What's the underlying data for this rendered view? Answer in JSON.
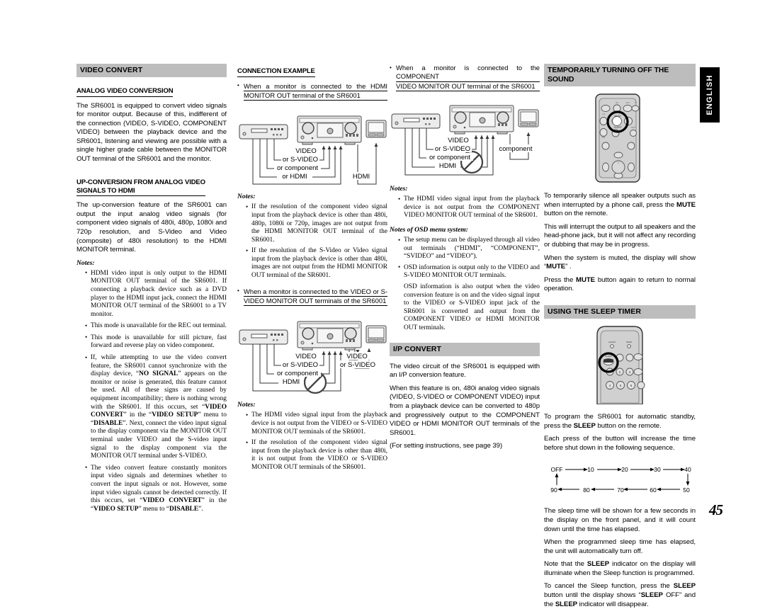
{
  "page": {
    "number": "45",
    "language_tab": "ENGLISH"
  },
  "col1": {
    "header": "VIDEO CONVERT",
    "sub1": "ANALOG VIDEO CONVERSION",
    "p1": "The SR6001 is equipped to convert video signals for monitor output. Because of this, indifferent of the connection (VIDEO, S-VIDEO, COMPONENT VIDEO) between the playback device and the SR6001, listening and viewing are possible with a single higher grade cable between the MONITOR OUT terminal of the SR6001 and the monitor.",
    "sub2_line1": "UP-CONVERSION FROM ANALOG VIDEO",
    "sub2_line2": "SIGNALS TO HDMI",
    "p2": "The up-conversion feature of the SR6001 can output the input analog video signals (for component video signals of 480i, 480p, 1080i and 720p resolution, and S-Video and Video (composite) of 480i resolution) to the HDMI MONITOR terminal.",
    "notes_label": "Notes:",
    "notes": [
      "HDMI video input is only output to the HDMI MONITOR OUT terminal of the SR6001. If connecting a playback device such as a DVD player to the HDMI input jack, connect the HDMI MONITOR OUT terminal of the SR6001 to a TV monitor.",
      "This mode is unavailable for the REC out terminal.",
      "This mode is unavailable for still picture, fast forward and reverse play on video component.",
      "If, while attempting to use the video convert feature, the SR6001 cannot synchronize with the display device, “NO SIGNAL” appears on the monitor or noise is generated, this feature cannot be used. All of these signs are caused by equipment incompatibility; there is nothing wrong with the SR6001. If this occurs, set “VIDEO CONVERT” in the “VIDEO SETUP” menu to “DISABLE”. Next, connect the video input signal to the display component via the MONITOR OUT terminal under VIDEO and the S-video input signal to the display component via the MONITOR OUT terminal under S-VIDEO.",
      "The video convert feature constantly monitors input video signals and determines whether to convert the input signals or not. However, some input video signals cannot be detected correctly. If this occurs, set “VIDEO CONVERT” in the “VIDEO SETUP” menu to “DISABLE”."
    ]
  },
  "col2": {
    "header": "CONNECTION EXAMPLE",
    "item1_line1": "When a monitor is connected to the HDMI",
    "item1_line2": "MONITOR OUT terminal of the SR6001",
    "diagram1_labels": [
      "VIDEO",
      "or S-VIDEO",
      "or component",
      "or HDMI",
      "HDMI"
    ],
    "notes_label_1": "Notes:",
    "notes1": [
      "If the resolution of the component video signal input from the playback device is other than 480i, 480p, 1080i or 720p, images are not output from the HDMI MONITOR OUT terminal of the SR6001.",
      "If the resolution of the S-Video or Video signal input from the playback device is other than 480i, images are not output from the HDMI MONITOR OUT terminal of the SR6001."
    ],
    "item2_line1": "When a monitor is connected to the VIDEO or S-",
    "item2_line2": "VIDEO MONITOR OUT terminals of the SR6001",
    "diagram2_labels": [
      "VIDEO",
      "or S-VIDEO",
      "or component",
      "HDMI",
      "VIDEO",
      "or S-VIDEO"
    ],
    "notes_label_2": "Notes:",
    "notes2": [
      "The HDMI video signal input from the playback device is not output from the VIDEO or S-VIDEO MONITOR OUT terminals of the SR6001.",
      "If the resolution of the component video signal input from the playback device is other than 480i, it is not output from the VIDEO or S-VIDEO MONITOR OUT terminals of the SR6001."
    ]
  },
  "col3": {
    "item3_line1": "When a monitor is connected to the COMPONENT",
    "item3_line2": "VIDEO MONITOR OUT terminal of the SR6001",
    "diagram3_labels": [
      "VIDEO",
      "or S-VIDEO",
      "or component",
      "HDMI",
      "component"
    ],
    "notes_label_1": "Notes:",
    "notes1": [
      "The HDMI video signal input from the playback device is not output from the COMPONENT VIDEO MONITOR OUT terminal of the SR6001."
    ],
    "notes_label_2": "Notes of OSD menu system:",
    "notes2": [
      "The setup menu can be displayed through all video out terminals (“HDMI”, “COMPONENT”, “SVIDEO” and “VIDEO”).",
      "OSD information is output only to the VIDEO and S-VIDEO MONITOR OUT terminals."
    ],
    "notes2_extra": "OSD information is also output when the video conversion feature is on and the video signal input to the VIDEO or S-VIDEO input jack of the SR6001 is converted and output from the COMPONENT VIDEO or HDMI MONITOR OUT terminals.",
    "header2": "I/P CONVERT",
    "p1": "The video circuit of the SR6001 is equipped with an I/P conversion feature.",
    "p2": "When this feature is on, 480i analog video signals (VIDEO, S-VIDEO or COMPONENT VIDEO) input from a playback device can be converted to 480p and progressively output to the COMPONENT VIDEO or HDMI MONITOR OUT terminals of the SR6001.",
    "p3": "(For setting instructions, see page 39)"
  },
  "col4": {
    "header1": "TEMPORARILY TURNING OFF  THE SOUND",
    "remote1_labels": [
      "MUTE",
      "SLEEP"
    ],
    "p1": "To temporarily silence all speaker outputs such as when interrupted by a phone call, press the MUTE button on the remote.",
    "p1_bold": "MUTE",
    "p2": "This will interrupt the output to all speakers and the head-phone jack, but it will not affect any recording or dubbing that may be in progress.",
    "p3": "When the system is muted, the display will show “MUTE” .",
    "p3_bold": "MUTE",
    "p4": "Press the MUTE button again to return to normal operation.",
    "header2": "USING THE SLEEP TIMER",
    "remote2_labels": [
      "LEARN",
      "SEND",
      "SLEEP"
    ],
    "p5": "To program the SR6001 for automatic standby, press the SLEEP button on the remote.",
    "p6": "Each press of the button will increase the time before shut down in the following sequence.",
    "sequence_top": [
      "OFF",
      "10",
      "20",
      "30",
      "40"
    ],
    "sequence_bottom": [
      "90",
      "80",
      "70",
      "60",
      "50"
    ],
    "p7": "The sleep time will be shown for a few seconds in the display on the front panel, and it will count down until the time has elapsed.",
    "p8": "When the programmed sleep time has elapsed, the unit will automatically turn off.",
    "p9": "Note that the SLEEP indicator on the display will illuminate when the Sleep function is programmed.",
    "p10": "To cancel the Sleep function, press the SLEEP button until the display shows “SLEEP OFF” and the SLEEP indicator will disappear."
  },
  "colors": {
    "header_bar": "#bdbdbd",
    "tab_background": "#000000",
    "text": "#000000",
    "device_fill": "#e8e8e8"
  }
}
